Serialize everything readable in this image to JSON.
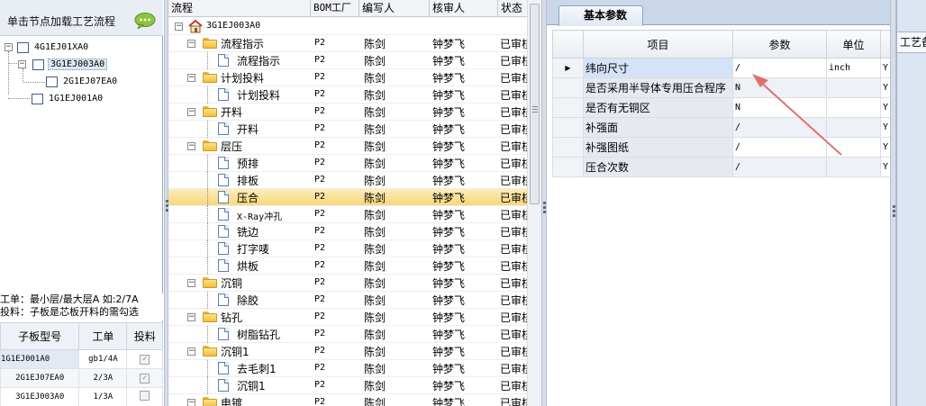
{
  "left_panel": {
    "title": "单击节点加载工艺流程",
    "tree": [
      {
        "label": "4G1EJ01XA0",
        "level": 0,
        "expand": "−"
      },
      {
        "label": "3G1EJ003A0",
        "level": 1,
        "expand": "−",
        "selected": true
      },
      {
        "label": "2G1EJ07EA0",
        "level": 2
      },
      {
        "label": "1G1EJ001A0",
        "level": 1
      }
    ],
    "note_line1": "工单：最小层/最大层A 如:2/7A",
    "note_line2": "投料：子板是芯板开料的需勾选",
    "sub_table": {
      "headers": [
        "子板型号",
        "工单",
        "投料"
      ],
      "rows": [
        {
          "model": "1G1EJ001A0",
          "order": "gb1/4A",
          "check": "✓"
        },
        {
          "model": "2G1EJ07EA0",
          "order": "2/3A",
          "check": "✓"
        },
        {
          "model": "3G1EJ003A0",
          "order": "1/3A",
          "check": ""
        }
      ]
    }
  },
  "process_grid": {
    "headers": {
      "flow": "流程",
      "bom": "BOM工厂",
      "author": "编写人",
      "reviewer": "核审人",
      "status": "状态"
    },
    "root": "3G1EJ003A0",
    "rows": [
      {
        "name": "流程指示",
        "folder": true,
        "expand": "−",
        "bom": "P2",
        "author": "陈剑",
        "reviewer": "钟梦飞",
        "status": "已审核"
      },
      {
        "name": "流程指示",
        "folder": false,
        "bom": "P2",
        "author": "陈剑",
        "reviewer": "钟梦飞",
        "status": "已审核"
      },
      {
        "name": "计划投料",
        "folder": true,
        "expand": "−",
        "bom": "P2",
        "author": "陈剑",
        "reviewer": "钟梦飞",
        "status": "已审核"
      },
      {
        "name": "计划投料",
        "folder": false,
        "bom": "P2",
        "author": "陈剑",
        "reviewer": "钟梦飞",
        "status": "已审核"
      },
      {
        "name": "开料",
        "folder": true,
        "expand": "−",
        "bom": "P2",
        "author": "陈剑",
        "reviewer": "钟梦飞",
        "status": "已审核"
      },
      {
        "name": "开料",
        "folder": false,
        "bom": "P2",
        "author": "陈剑",
        "reviewer": "钟梦飞",
        "status": "已审核"
      },
      {
        "name": "层压",
        "folder": true,
        "expand": "−",
        "bom": "P2",
        "author": "陈剑",
        "reviewer": "钟梦飞",
        "status": "已审核"
      },
      {
        "name": "预排",
        "folder": false,
        "bom": "P2",
        "author": "陈剑",
        "reviewer": "钟梦飞",
        "status": "已审核"
      },
      {
        "name": "排板",
        "folder": false,
        "bom": "P2",
        "author": "陈剑",
        "reviewer": "钟梦飞",
        "status": "已审核"
      },
      {
        "name": "压合",
        "folder": false,
        "selected": true,
        "bom": "P2",
        "author": "陈剑",
        "reviewer": "钟梦飞",
        "status": "已审核"
      },
      {
        "name": "X-Ray冲孔",
        "folder": false,
        "bom": "P2",
        "author": "陈剑",
        "reviewer": "钟梦飞",
        "status": "已审核"
      },
      {
        "name": "铣边",
        "folder": false,
        "bom": "P2",
        "author": "陈剑",
        "reviewer": "钟梦飞",
        "status": "已审核"
      },
      {
        "name": "打字唛",
        "folder": false,
        "bom": "P2",
        "author": "陈剑",
        "reviewer": "钟梦飞",
        "status": "已审核"
      },
      {
        "name": "烘板",
        "folder": false,
        "bom": "P2",
        "author": "陈剑",
        "reviewer": "钟梦飞",
        "status": "已审核"
      },
      {
        "name": "沉铜",
        "folder": true,
        "expand": "−",
        "bom": "P2",
        "author": "陈剑",
        "reviewer": "钟梦飞",
        "status": "已审核"
      },
      {
        "name": "除胶",
        "folder": false,
        "bom": "P2",
        "author": "陈剑",
        "reviewer": "钟梦飞",
        "status": "已审核"
      },
      {
        "name": "钻孔",
        "folder": true,
        "expand": "−",
        "bom": "P2",
        "author": "陈剑",
        "reviewer": "钟梦飞",
        "status": "已审核"
      },
      {
        "name": "树脂钻孔",
        "folder": false,
        "bom": "P2",
        "author": "陈剑",
        "reviewer": "钟梦飞",
        "status": "已审核"
      },
      {
        "name": "沉铜1",
        "folder": true,
        "expand": "−",
        "bom": "P2",
        "author": "陈剑",
        "reviewer": "钟梦飞",
        "status": "已审核"
      },
      {
        "name": "去毛刺1",
        "folder": false,
        "bom": "P2",
        "author": "陈剑",
        "reviewer": "钟梦飞",
        "status": "已审核"
      },
      {
        "name": "沉铜1",
        "folder": false,
        "bom": "P2",
        "author": "陈剑",
        "reviewer": "钟梦飞",
        "status": "已审核"
      },
      {
        "name": "电镀",
        "folder": true,
        "expand": "−",
        "bom": "P2",
        "author": "陈剑",
        "reviewer": "钟梦飞",
        "status": "已审核"
      }
    ]
  },
  "params_panel": {
    "tab": "基本参数",
    "headers": {
      "item": "项目",
      "param": "参数",
      "unit": "单位",
      "extra": ""
    },
    "current_marker": "▶",
    "rows": [
      {
        "item": "纬向尺寸",
        "param": "/",
        "unit": "inch",
        "flag": "Y",
        "current": true
      },
      {
        "item": "是否采用半导体专用压合程序",
        "param": "N",
        "unit": "",
        "flag": "Y"
      },
      {
        "item": "是否有无铜区",
        "param": "N",
        "unit": "",
        "flag": "Y"
      },
      {
        "item": "补强面",
        "param": "/",
        "unit": "",
        "flag": "Y"
      },
      {
        "item": "补强图纸",
        "param": "/",
        "unit": "",
        "flag": "Y"
      },
      {
        "item": "压合次数",
        "param": "/",
        "unit": "",
        "flag": "Y"
      }
    ]
  },
  "far_panel": {
    "tab": "工艺备"
  },
  "colors": {
    "selection": "#f7d77a",
    "arrow": "#e07070",
    "tab_bg": "#c9d7e8"
  }
}
